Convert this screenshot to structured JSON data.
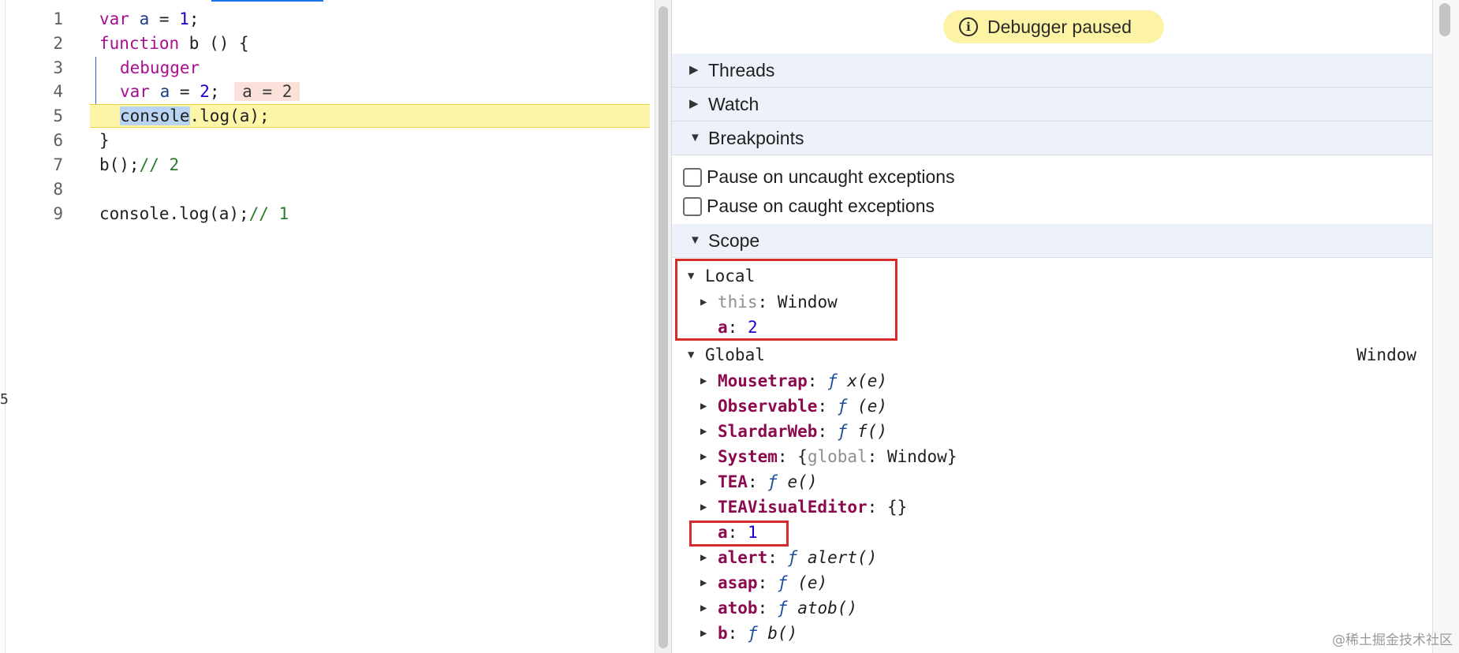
{
  "editor": {
    "lines": [
      {
        "n": "1"
      },
      {
        "n": "2"
      },
      {
        "n": "3"
      },
      {
        "n": "4"
      },
      {
        "n": "5"
      },
      {
        "n": "6"
      },
      {
        "n": "7"
      },
      {
        "n": "8"
      },
      {
        "n": "9"
      }
    ],
    "tokens": {
      "l1_kw": "var",
      "l1_var": "a",
      "l1_op": " = ",
      "l1_num": "1",
      "l1_end": ";",
      "l2_kw": "function",
      "l2_rest": " b () {",
      "l3_kw": "debugger",
      "l4_kw": "var",
      "l4_var": "a",
      "l4_op": " = ",
      "l4_num": "2",
      "l4_end": ";",
      "l4_inline": "a = 2",
      "l5_sel": "console",
      "l5_rest": ".log(a);",
      "l6": "}",
      "l7_code": "b();",
      "l7_cmt": "// 2",
      "l9_code": "console.log(a);",
      "l9_cmt": "// 1"
    },
    "current_line": 5,
    "gutter_fragment": "5"
  },
  "debugger": {
    "status": "Debugger paused",
    "sections": {
      "threads": "Threads",
      "watch": "Watch",
      "breakpoints": "Breakpoints",
      "scope": "Scope"
    },
    "breakpoint_options": [
      {
        "label": "Pause on uncaught exceptions",
        "checked": false
      },
      {
        "label": "Pause on caught exceptions",
        "checked": false
      }
    ],
    "scope": {
      "local": {
        "label": "Local",
        "this_key": "this",
        "this_value": "Window",
        "a_key": "a",
        "a_value": "2"
      },
      "global": {
        "label": "Global",
        "right_label": "Window",
        "items": [
          {
            "key": "Mousetrap",
            "f": "ƒ",
            "sig": "x(e)"
          },
          {
            "key": "Observable",
            "f": "ƒ",
            "sig": "(e)"
          },
          {
            "key": "SlardarWeb",
            "f": "ƒ",
            "sig": "f()"
          },
          {
            "key": "System",
            "obj_open": "{",
            "obj_key": "global",
            "obj_val": ": Window}"
          },
          {
            "key": "TEA",
            "f": "ƒ",
            "sig": "e()"
          },
          {
            "key": "TEAVisualEditor",
            "plain": "{}"
          },
          {
            "key": "a",
            "value": "1"
          },
          {
            "key": "alert",
            "f": "ƒ",
            "sig": "alert()"
          },
          {
            "key": "asap",
            "f": "ƒ",
            "sig": "(e)"
          },
          {
            "key": "atob",
            "f": "ƒ",
            "sig": "atob()"
          },
          {
            "key": "b",
            "f": "ƒ",
            "sig": "b()"
          }
        ]
      }
    }
  },
  "watermark": "@稀土掘金技术社区",
  "colors": {
    "paused_bg": "#fcf3a4",
    "current_line_bg": "#fdf6a9",
    "section_bg": "#ecf1fa",
    "highlight_box": "#d52b2b",
    "property": "#8b0a4f",
    "number": "#1c00cf"
  }
}
